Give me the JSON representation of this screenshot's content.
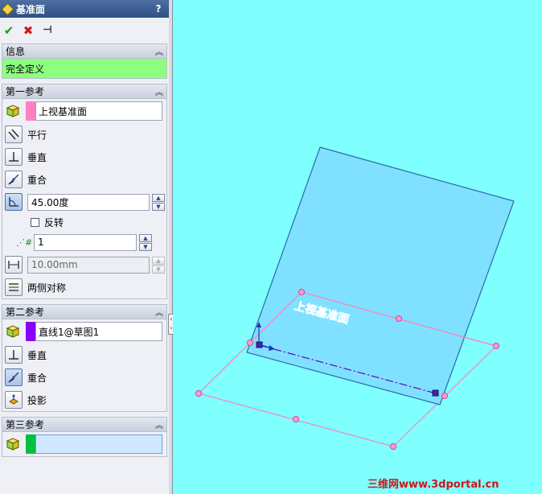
{
  "panel": {
    "title": "基准面",
    "help_label": "?",
    "actions": {
      "ok_symbol": "✔",
      "cancel_symbol": "✖",
      "pin_symbol": "⊣"
    },
    "info": {
      "header": "信息",
      "status": "完全定义"
    },
    "ref1": {
      "header": "第一参考",
      "selection": "上视基准面",
      "swatch_color": "#ff7fc3",
      "options": [
        {
          "label": "平行",
          "icon": "parallel-icon"
        },
        {
          "label": "垂直",
          "icon": "perpendicular-icon"
        },
        {
          "label": "重合",
          "icon": "coincident-icon"
        }
      ],
      "angle_value": "45.00度",
      "flip_label": "反转",
      "count_value": "1",
      "distance_value": "10.00mm",
      "symmetric_label": "两侧对称"
    },
    "ref2": {
      "header": "第二参考",
      "selection": "直线1@草图1",
      "swatch_color": "#8a00ff",
      "options": [
        {
          "label": "垂直",
          "icon": "perpendicular-icon"
        },
        {
          "label": "重合",
          "icon": "coincident-icon"
        },
        {
          "label": "投影",
          "icon": "project-icon"
        }
      ]
    },
    "ref3": {
      "header": "第三参考",
      "selection": "",
      "swatch_color": "#00c040"
    }
  },
  "viewport": {
    "plane_label": "上视基准面",
    "watermark": "三维网www.3dportal.cn",
    "background_color": "#80ffff",
    "new_plane_color": "#7fdcff",
    "ref_plane_color": "#ff80c0"
  }
}
